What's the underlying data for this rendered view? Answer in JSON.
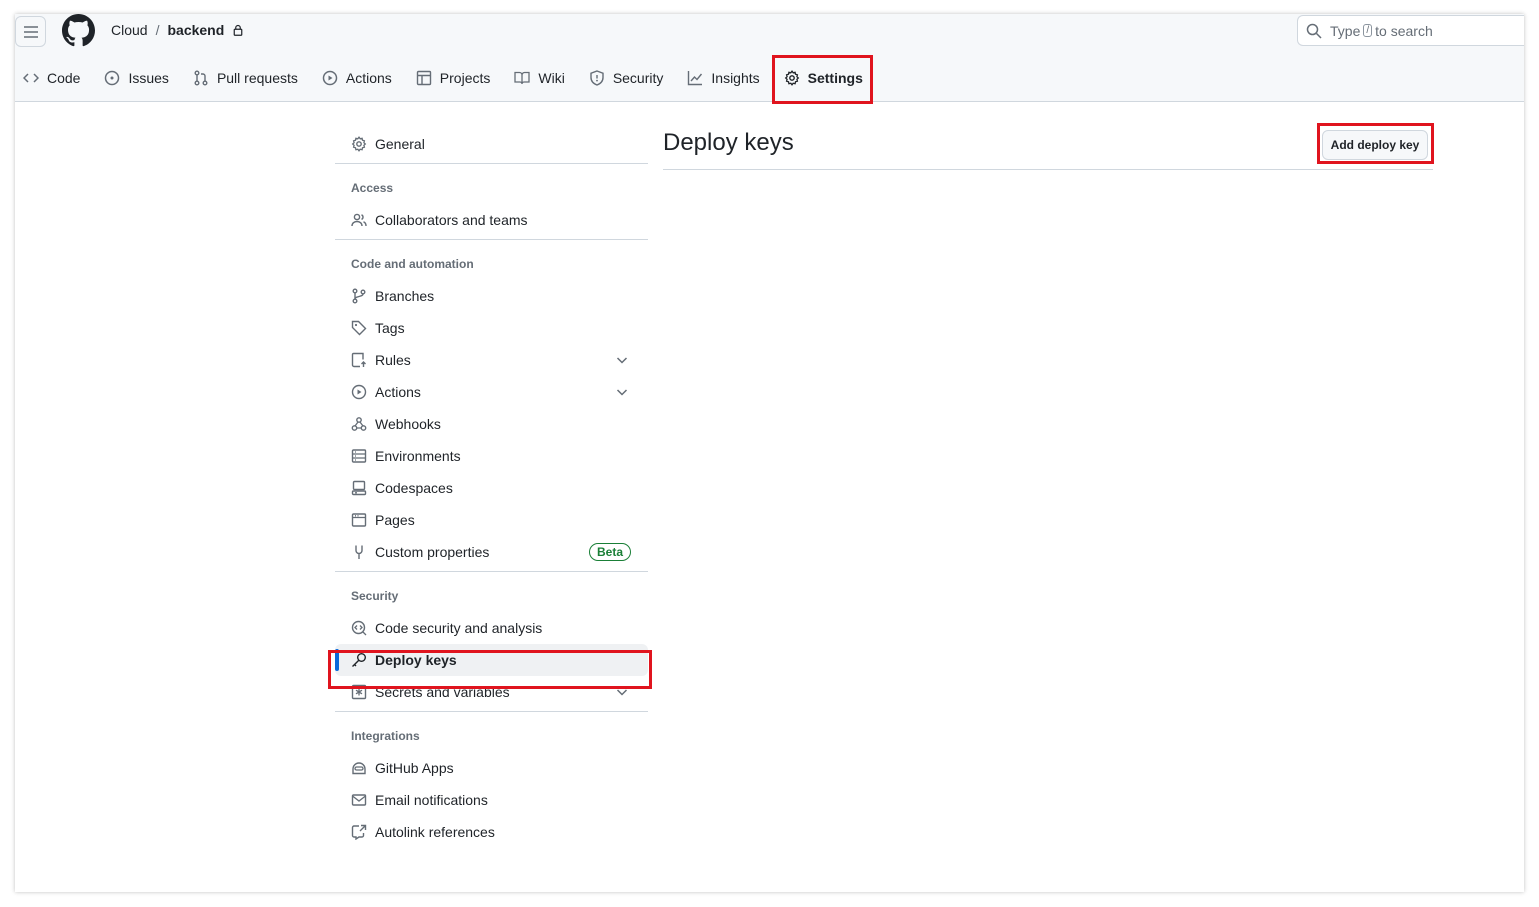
{
  "header": {
    "owner": "Cloud",
    "separator": "/",
    "repo": "backend",
    "search": {
      "prefix": "Type",
      "key": "/",
      "suffix": "to search"
    }
  },
  "tabs": [
    {
      "label": "Code",
      "icon": "code-icon"
    },
    {
      "label": "Issues",
      "icon": "issue-icon"
    },
    {
      "label": "Pull requests",
      "icon": "pull-request-icon"
    },
    {
      "label": "Actions",
      "icon": "play-icon"
    },
    {
      "label": "Projects",
      "icon": "table-icon"
    },
    {
      "label": "Wiki",
      "icon": "book-icon"
    },
    {
      "label": "Security",
      "icon": "shield-icon"
    },
    {
      "label": "Insights",
      "icon": "graph-icon"
    },
    {
      "label": "Settings",
      "icon": "gear-icon",
      "active": true
    }
  ],
  "sidebar": {
    "general": "General",
    "access": {
      "heading": "Access",
      "items": [
        "Collaborators and teams"
      ]
    },
    "code_automation": {
      "heading": "Code and automation",
      "items": [
        "Branches",
        "Tags",
        "Rules",
        "Actions",
        "Webhooks",
        "Environments",
        "Codespaces",
        "Pages",
        "Custom properties"
      ],
      "beta_label": "Beta"
    },
    "security": {
      "heading": "Security",
      "items": [
        "Code security and analysis",
        "Deploy keys",
        "Secrets and variables"
      ]
    },
    "integrations": {
      "heading": "Integrations",
      "items": [
        "GitHub Apps",
        "Email notifications",
        "Autolink references"
      ]
    }
  },
  "main": {
    "title": "Deploy keys",
    "add_button": "Add deploy key"
  },
  "colors": {
    "highlight": "#e0141e",
    "active_indicator": "#0969da",
    "beta": "#1a7f37"
  }
}
